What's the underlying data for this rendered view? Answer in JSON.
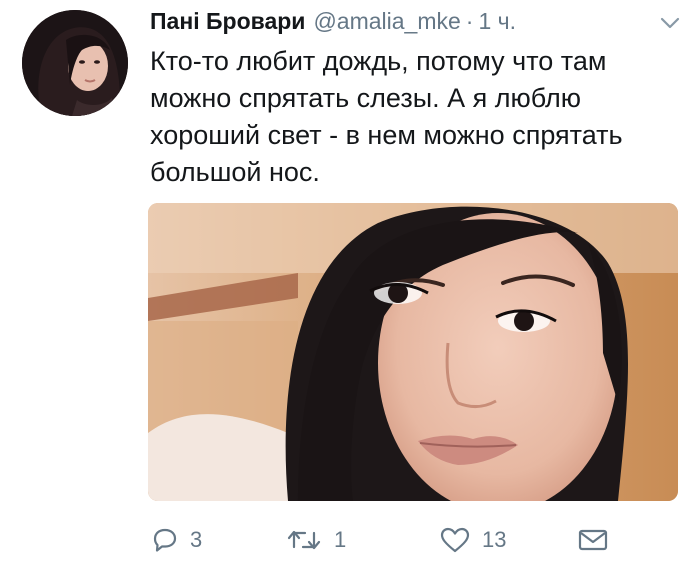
{
  "tweet": {
    "display_name": "Пані Бровари",
    "handle": "@amalia_mke",
    "separator": "·",
    "time": "1 ч.",
    "text": "Кто-то любит дождь, потому что там можно спрятать слезы. А я люблю хороший свет - в нем можно спрятать большой нос."
  },
  "actions": {
    "replies": "3",
    "retweets": "1",
    "likes": "13"
  },
  "icons": {
    "reply": "reply-icon",
    "retweet": "retweet-icon",
    "like": "heart-icon",
    "dm": "envelope-icon",
    "menu": "chevron-down-icon"
  },
  "colors": {
    "text": "#14171a",
    "secondary": "#657786"
  }
}
